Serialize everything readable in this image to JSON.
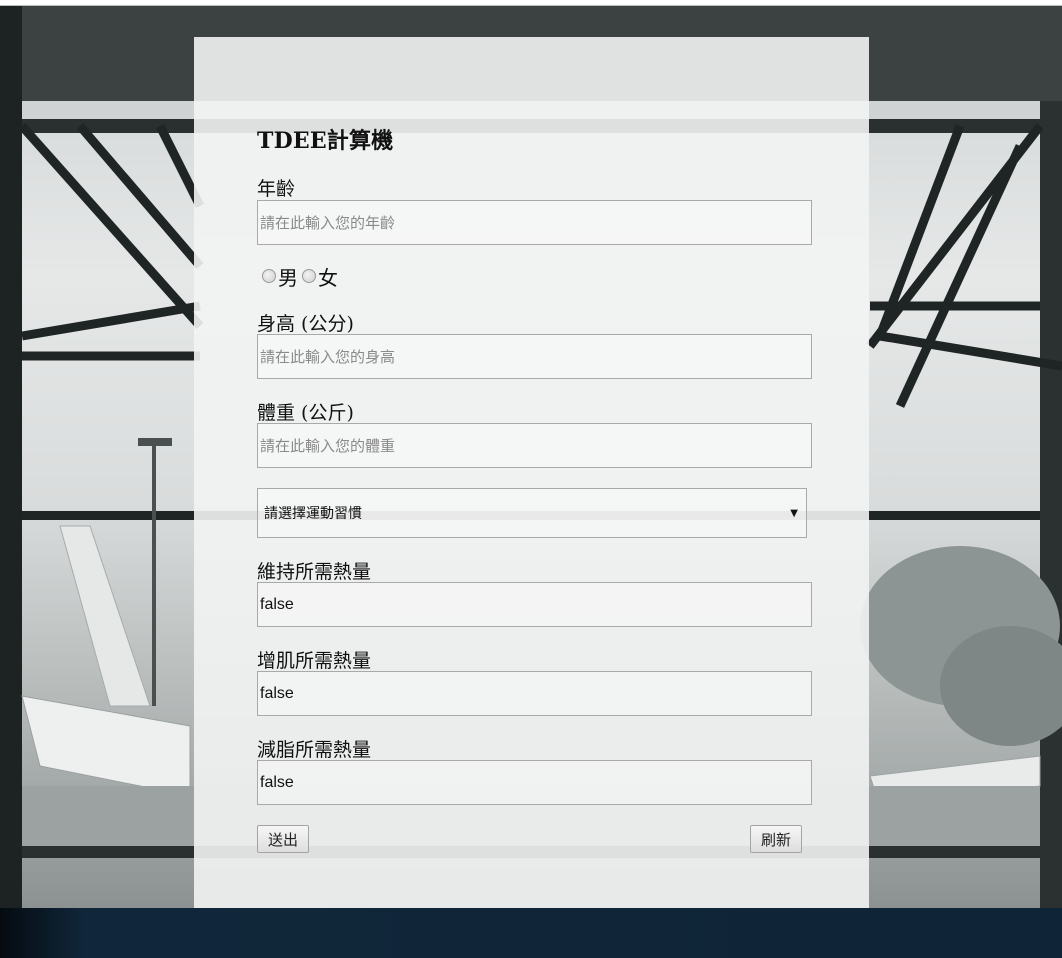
{
  "form": {
    "title": "TDEE計算機",
    "age": {
      "label": "年齡",
      "placeholder": "請在此輸入您的年齡"
    },
    "gender": {
      "male": "男",
      "female": "女"
    },
    "height": {
      "label": "身高 (公分)",
      "placeholder": "請在此輸入您的身高"
    },
    "weight": {
      "label": "體重 (公斤)",
      "placeholder": "請在此輸入您的體重"
    },
    "activity": {
      "selected": "請選擇運動習慣"
    },
    "maintain": {
      "label": "維持所需熱量",
      "value": "false"
    },
    "bulk": {
      "label": "增肌所需熱量",
      "value": "false"
    },
    "cut": {
      "label": "減脂所需熱量",
      "value": "false"
    },
    "submit_label": "送出",
    "refresh_label": "刷新"
  }
}
